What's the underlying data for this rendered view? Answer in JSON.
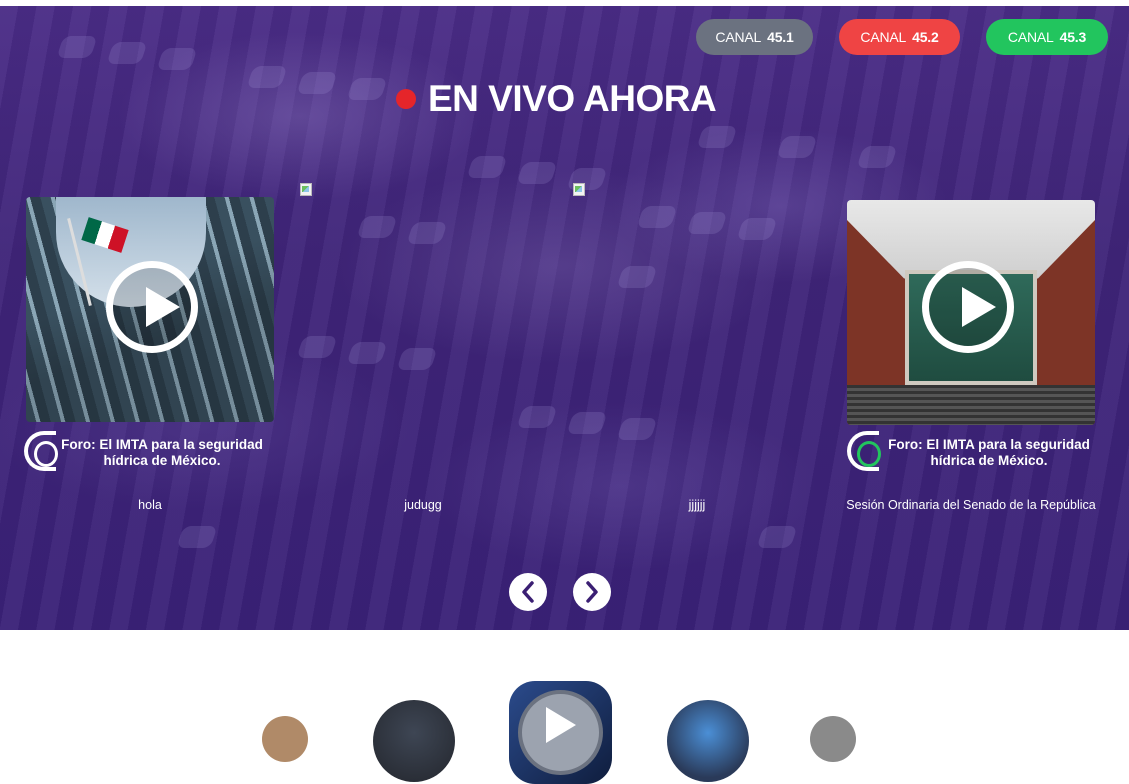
{
  "channels": [
    {
      "prefix": "CANAL",
      "number": "45.1",
      "color": "#6b7280"
    },
    {
      "prefix": "CANAL",
      "number": "45.2",
      "color": "#ef4444"
    },
    {
      "prefix": "CANAL",
      "number": "45.3",
      "color": "#22c55e"
    }
  ],
  "live": {
    "title": "EN VIVO AHORA",
    "dot_color": "#e5252a"
  },
  "cards": [
    {
      "overlay": "Foro: El IMTA para la seguridad\nhídrica de México.",
      "caption": "hola"
    },
    {
      "caption": "judugg"
    },
    {
      "caption": "jjjjjj"
    },
    {
      "overlay": "Foro: El IMTA para la seguridad\nhídrica de México.",
      "caption": "Sesión Ordinaria del Senado de la República"
    }
  ],
  "accent_color": "#4a2c86"
}
